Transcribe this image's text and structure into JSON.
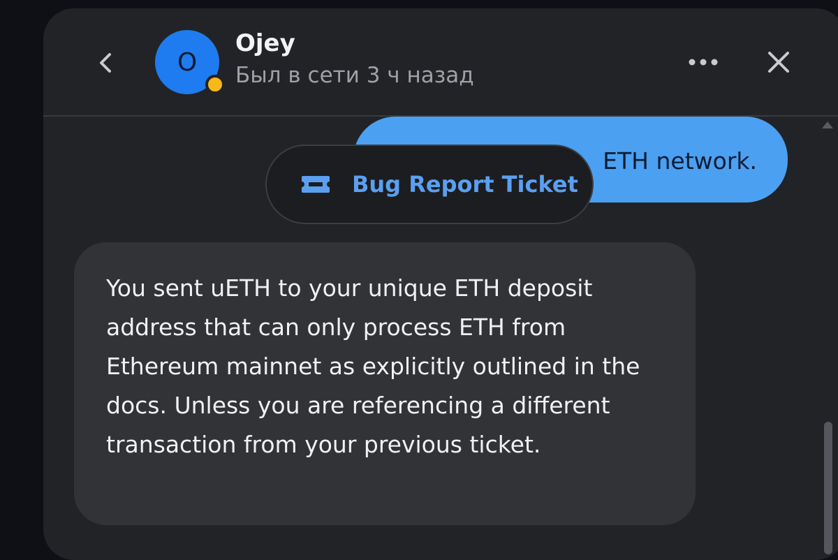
{
  "header": {
    "back_icon": "chevron-left-icon",
    "avatar_letter": "O",
    "avatar_color": "#1f7bf0",
    "status_color": "#f6b91a",
    "contact_name": "Ojey",
    "contact_status": "Был в сети 3 ч назад",
    "more_icon": "more-horizontal-icon",
    "close_icon": "close-icon"
  },
  "chat": {
    "outgoing_message_visible_text": "ETH network.",
    "ticket_chip": {
      "icon": "ticket-icon",
      "label": "Bug Report Ticket"
    },
    "incoming_message": "You sent uETH to your unique ETH deposit address that can only process ETH from Ethereum mainnet as explicitly outlined in the docs. Unless you are referencing a different transaction from your previous ticket."
  },
  "colors": {
    "accent": "#4ba0f2",
    "ticket_label": "#5b9ff0"
  }
}
